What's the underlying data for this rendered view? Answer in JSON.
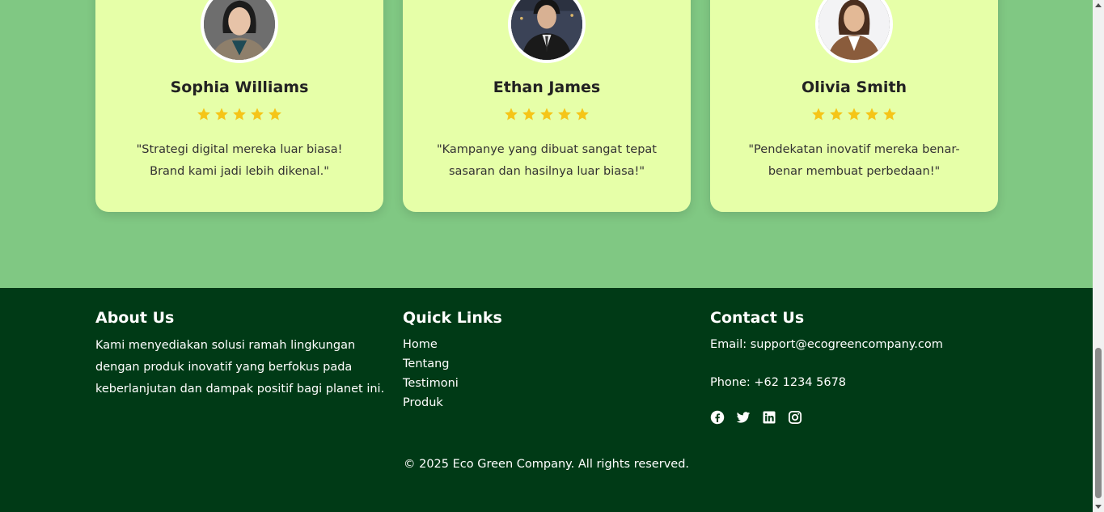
{
  "testimonials": [
    {
      "name": "Sophia Williams",
      "rating": 5,
      "quote": "\"Strategi digital mereka luar biasa! Brand kami jadi lebih dikenal.\""
    },
    {
      "name": "Ethan James",
      "rating": 5,
      "quote": "\"Kampanye yang dibuat sangat tepat sasaran dan hasilnya luar biasa!\""
    },
    {
      "name": "Olivia Smith",
      "rating": 5,
      "quote": "\"Pendekatan inovatif mereka benar-benar membuat perbedaan!\""
    }
  ],
  "footer": {
    "about": {
      "title": "About Us",
      "text": "Kami menyediakan solusi ramah lingkungan dengan produk inovatif yang berfokus pada keberlanjutan dan dampak positif bagi planet ini."
    },
    "links": {
      "title": "Quick Links",
      "items": [
        "Home",
        "Tentang",
        "Testimoni",
        "Produk"
      ]
    },
    "contact": {
      "title": "Contact Us",
      "email": "Email: support@ecogreencompany.com",
      "phone": "Phone: +62 1234 5678",
      "socials": [
        "facebook-icon",
        "twitter-icon",
        "linkedin-icon",
        "instagram-icon"
      ]
    },
    "copyright": "© 2025 Eco Green Company. All rights reserved."
  },
  "colors": {
    "section_bg": "#80c883",
    "card_bg": "#e6ffa8",
    "footer_bg": "#003a16",
    "star": "#f5c518"
  }
}
